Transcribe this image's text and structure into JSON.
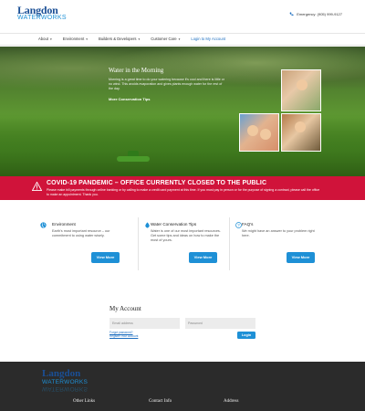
{
  "header": {
    "logo_line1": "Langdon",
    "logo_line2": "WATERWORKS",
    "emergency": "Emergency: (905) 999-9127"
  },
  "nav": {
    "items": [
      {
        "label": "About",
        "caret": "▾"
      },
      {
        "label": "Environment",
        "caret": "▾"
      },
      {
        "label": "Builders & Developers",
        "caret": "▾"
      },
      {
        "label": "Customer Care",
        "caret": "▾"
      },
      {
        "label": "Login to My Account",
        "caret": ""
      }
    ]
  },
  "hero": {
    "title": "Water in the Morning",
    "body": "Morning is a great time to do your watering because it's cool and there is little or no wind. This avoids evaporation and gives plants enough water for the rest of the day.",
    "link": "More Conservation Tips"
  },
  "covid": {
    "title": "COVID-19 PANDEMIC – OFFICE CURRENTLY CLOSED TO THE PUBLIC",
    "body": "Please make bill payments through online banking or by calling to make a credit card payment at this time. If you must pay in person or for the purpose of signing a contract, please call the office to make an appointment. Thank you."
  },
  "features": [
    {
      "title": "Environment",
      "body": "Earth's most important resource – our commitment to using water wisely.",
      "button": "View More",
      "icon": "globe-icon"
    },
    {
      "title": "Water Conservation Tips",
      "body": "Water is one of our most important resources. Get some tips and ideas on how to make the most of yours.",
      "button": "View More",
      "icon": "water-drop-icon"
    },
    {
      "title": "FAQ's",
      "body": "We might have an answer to your problem right here.",
      "button": "View More",
      "icon": "question-icon"
    }
  ],
  "account": {
    "title": "My Account",
    "email_placeholder": "Email address",
    "password_placeholder": "Password",
    "forgot_link": "Forgot password?",
    "register_link": "Register Your Account",
    "login_button": "Login"
  },
  "footer": {
    "logo_line1": "Langdon",
    "logo_line2": "WATERWORKS",
    "columns": [
      "Other Links",
      "Contact Info",
      "Address"
    ]
  },
  "colors": {
    "brand_blue": "#1e90d6",
    "brand_navy": "#1a4f96",
    "covid_red": "#d0133a",
    "footer_bg": "#2b2b2b"
  }
}
